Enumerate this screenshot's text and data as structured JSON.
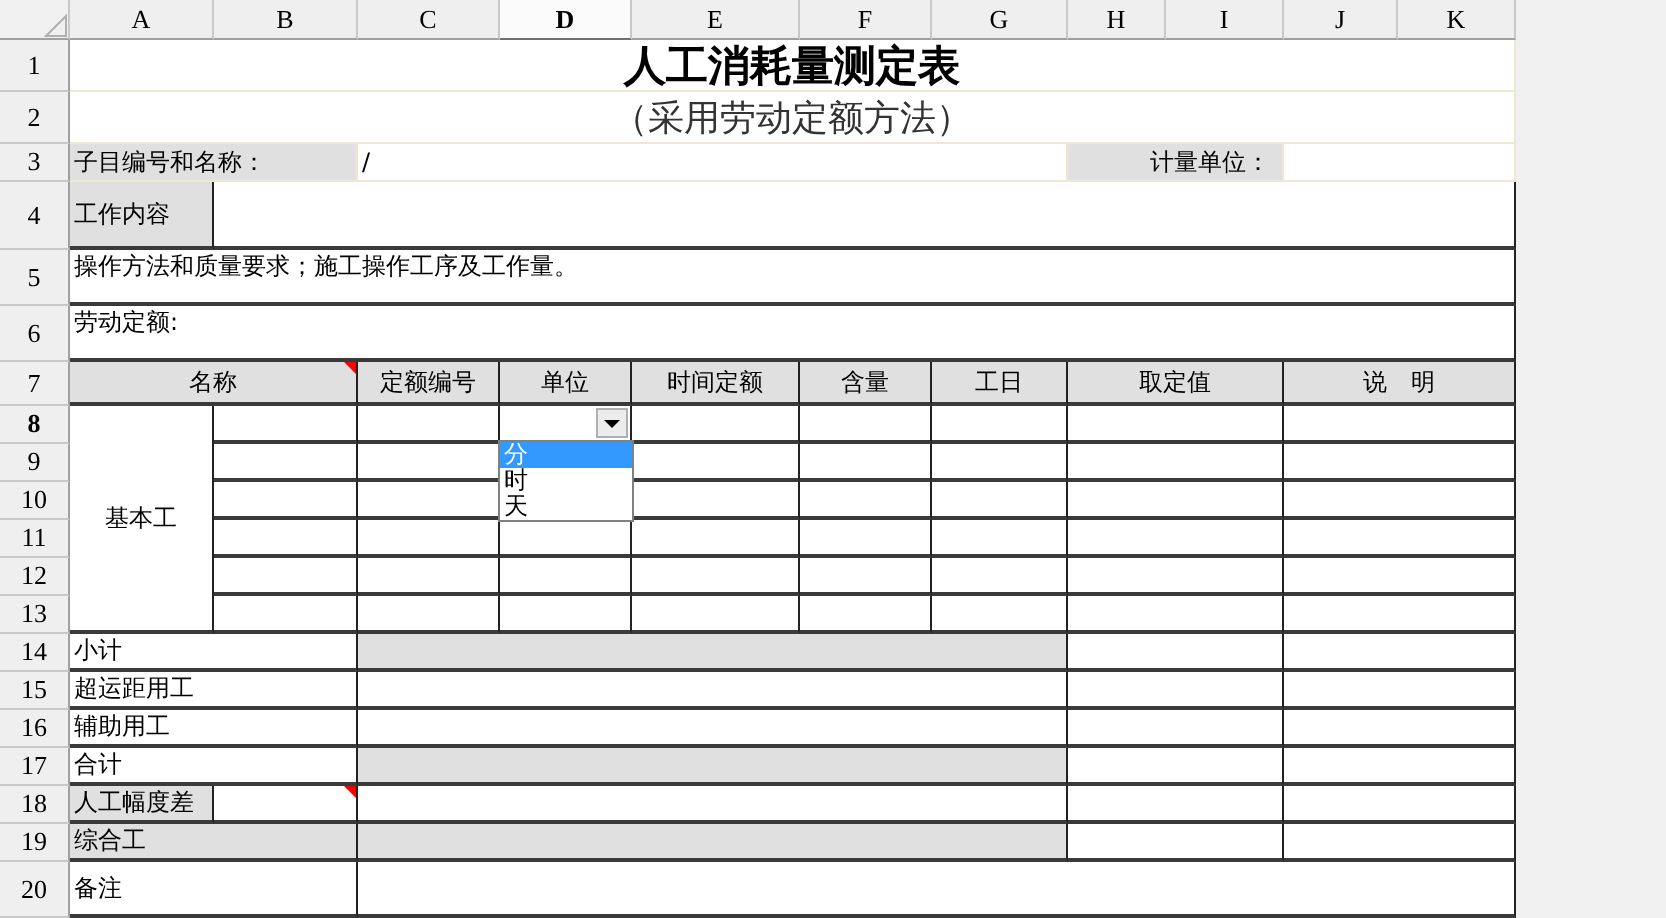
{
  "columns": [
    {
      "label": "A",
      "selected": false
    },
    {
      "label": "B",
      "selected": false
    },
    {
      "label": "C",
      "selected": false
    },
    {
      "label": "D",
      "selected": true
    },
    {
      "label": "E",
      "selected": false
    },
    {
      "label": "F",
      "selected": false
    },
    {
      "label": "G",
      "selected": false
    },
    {
      "label": "H",
      "selected": false
    },
    {
      "label": "I",
      "selected": false
    },
    {
      "label": "J",
      "selected": false
    },
    {
      "label": "K",
      "selected": false
    }
  ],
  "rows": [
    {
      "label": "1",
      "selected": false,
      "cells": [
        {
          "text": "人工消耗量测定表"
        }
      ]
    },
    {
      "label": "2",
      "selected": false,
      "cells": [
        {
          "text": "（采用劳动定额方法）"
        }
      ]
    },
    {
      "label": "3",
      "selected": false,
      "cells": [
        {
          "text": "子目编号和名称："
        },
        {
          "text": "/"
        },
        {
          "text": "计量单位："
        }
      ]
    },
    {
      "label": "4",
      "selected": false,
      "cells": [
        {
          "text": "工作内容"
        }
      ]
    },
    {
      "label": "5",
      "selected": false,
      "cells": [
        {
          "text": "操作方法和质量要求；施工操作工序及工作量。"
        }
      ]
    },
    {
      "label": "6",
      "selected": false,
      "cells": [
        {
          "text": "劳动定额:"
        }
      ]
    },
    {
      "label": "7",
      "selected": false,
      "cells": [
        {
          "text": "名称",
          "comment": true
        },
        {
          "text": "定额编号"
        },
        {
          "text": "单位"
        },
        {
          "text": "时间定额"
        },
        {
          "text": "含量"
        },
        {
          "text": "工日"
        },
        {
          "text": "取定值"
        },
        {
          "text": "说　明"
        }
      ]
    },
    {
      "label": "8",
      "selected": true,
      "cells": [
        {
          "text": "基本工"
        }
      ]
    },
    {
      "label": "9",
      "selected": false
    },
    {
      "label": "10",
      "selected": false
    },
    {
      "label": "11",
      "selected": false
    },
    {
      "label": "12",
      "selected": false
    },
    {
      "label": "13",
      "selected": false
    },
    {
      "label": "14",
      "selected": false,
      "cells": [
        {
          "text": "小计"
        }
      ]
    },
    {
      "label": "15",
      "selected": false,
      "cells": [
        {
          "text": "超运距用工"
        }
      ]
    },
    {
      "label": "16",
      "selected": false,
      "cells": [
        {
          "text": "辅助用工"
        }
      ]
    },
    {
      "label": "17",
      "selected": false,
      "cells": [
        {
          "text": "合计"
        }
      ]
    },
    {
      "label": "18",
      "selected": false,
      "cells": [
        {
          "text": "人工幅度差"
        },
        {
          "comment": true
        }
      ]
    },
    {
      "label": "19",
      "selected": false,
      "cells": [
        {
          "text": "综合工"
        }
      ]
    },
    {
      "label": "20",
      "selected": false,
      "cells": [
        {
          "text": "备注"
        }
      ]
    }
  ],
  "dropdown": {
    "options": [
      {
        "label": "分",
        "selected": true
      },
      {
        "label": "时",
        "selected": false
      },
      {
        "label": "天",
        "selected": false
      }
    ]
  }
}
